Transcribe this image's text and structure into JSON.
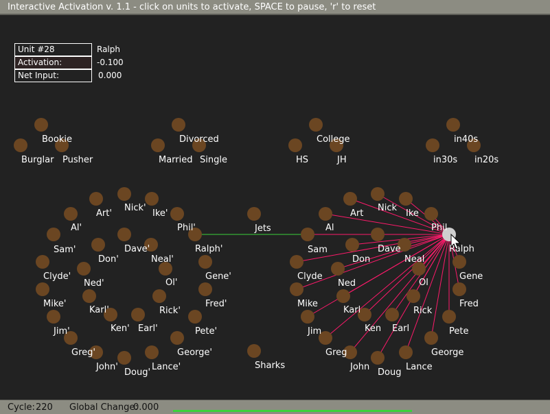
{
  "window": {
    "title": "Interactive Activation v. 1.1 - click on units to activate, SPACE to pause, 'r' to reset"
  },
  "info": {
    "unit_label": "Unit #28",
    "unit_name": "Ralph",
    "activation_label": "Activation:",
    "activation_value": "-0.100",
    "net_input_label": "Net Input:",
    "net_input_value": "0.000"
  },
  "status": {
    "cycle_label": "Cycle:",
    "cycle_value": "220",
    "global_change_label": "Global Change:",
    "global_change_value": "0.000",
    "progress_fraction": 1.0
  },
  "colors": {
    "background": "#222222",
    "unit_fill": "#6b4622",
    "selected_unit": "#cfcfcf",
    "label": "#ffffff",
    "excitatory_link": "#3bd23b",
    "inhibitory_link": "#ff1a6b"
  },
  "selected_unit": "Ralph",
  "groups": {
    "occupation": [
      "Bookie",
      "Burglar",
      "Pusher"
    ],
    "marital": [
      "Divorced",
      "Married",
      "Single"
    ],
    "education": [
      "College",
      "HS",
      "JH"
    ],
    "age": [
      "in40s",
      "in30s",
      "in20s"
    ],
    "gang": [
      "Jets",
      "Sharks"
    ]
  },
  "units": [
    {
      "name": "Bookie"
    },
    {
      "name": "Burglar"
    },
    {
      "name": "Pusher"
    },
    {
      "name": "Divorced"
    },
    {
      "name": "Married"
    },
    {
      "name": "Single"
    },
    {
      "name": "College"
    },
    {
      "name": "HS"
    },
    {
      "name": "JH"
    },
    {
      "name": "in40s"
    },
    {
      "name": "in30s"
    },
    {
      "name": "in20s"
    },
    {
      "name": "Jets"
    },
    {
      "name": "Sharks"
    },
    {
      "name": "Art'"
    },
    {
      "name": "Nick'"
    },
    {
      "name": "Ike'"
    },
    {
      "name": "Al'"
    },
    {
      "name": "Phil'"
    },
    {
      "name": "Sam'"
    },
    {
      "name": "Dave'"
    },
    {
      "name": "Don'"
    },
    {
      "name": "Neal'"
    },
    {
      "name": "Ralph'"
    },
    {
      "name": "Clyde'"
    },
    {
      "name": "Ned'"
    },
    {
      "name": "Ol'"
    },
    {
      "name": "Gene'"
    },
    {
      "name": "Mike'"
    },
    {
      "name": "Karl'"
    },
    {
      "name": "Rick'"
    },
    {
      "name": "Fred'"
    },
    {
      "name": "Jim'"
    },
    {
      "name": "Ken'"
    },
    {
      "name": "Earl'"
    },
    {
      "name": "Pete'"
    },
    {
      "name": "Greg'"
    },
    {
      "name": "John'"
    },
    {
      "name": "Doug'"
    },
    {
      "name": "Lance'"
    },
    {
      "name": "George'"
    },
    {
      "name": "Art"
    },
    {
      "name": "Nick"
    },
    {
      "name": "Ike"
    },
    {
      "name": "Al"
    },
    {
      "name": "Phil"
    },
    {
      "name": "Sam"
    },
    {
      "name": "Dave"
    },
    {
      "name": "Don"
    },
    {
      "name": "Neal"
    },
    {
      "name": "Ralph"
    },
    {
      "name": "Clyde"
    },
    {
      "name": "Ned"
    },
    {
      "name": "Ol"
    },
    {
      "name": "Gene"
    },
    {
      "name": "Mike"
    },
    {
      "name": "Karl"
    },
    {
      "name": "Rick"
    },
    {
      "name": "Fred"
    },
    {
      "name": "Jim"
    },
    {
      "name": "Ken"
    },
    {
      "name": "Earl"
    },
    {
      "name": "Pete"
    },
    {
      "name": "Greg"
    },
    {
      "name": "John"
    },
    {
      "name": "Doug"
    },
    {
      "name": "Lance"
    },
    {
      "name": "George"
    }
  ],
  "links": [
    {
      "from": "Ralph",
      "to": "Ralph'",
      "kind": "excitatory"
    },
    {
      "from": "Ralph",
      "to": "Art",
      "kind": "inhibitory"
    },
    {
      "from": "Ralph",
      "to": "Nick",
      "kind": "inhibitory"
    },
    {
      "from": "Ralph",
      "to": "Ike",
      "kind": "inhibitory"
    },
    {
      "from": "Ralph",
      "to": "Al",
      "kind": "inhibitory"
    },
    {
      "from": "Ralph",
      "to": "Phil",
      "kind": "inhibitory"
    },
    {
      "from": "Ralph",
      "to": "Sam",
      "kind": "inhibitory"
    },
    {
      "from": "Ralph",
      "to": "Dave",
      "kind": "inhibitory"
    },
    {
      "from": "Ralph",
      "to": "Don",
      "kind": "inhibitory"
    },
    {
      "from": "Ralph",
      "to": "Neal",
      "kind": "inhibitory"
    },
    {
      "from": "Ralph",
      "to": "Clyde",
      "kind": "inhibitory"
    },
    {
      "from": "Ralph",
      "to": "Ned",
      "kind": "inhibitory"
    },
    {
      "from": "Ralph",
      "to": "Ol",
      "kind": "inhibitory"
    },
    {
      "from": "Ralph",
      "to": "Gene",
      "kind": "inhibitory"
    },
    {
      "from": "Ralph",
      "to": "Mike",
      "kind": "inhibitory"
    },
    {
      "from": "Ralph",
      "to": "Karl",
      "kind": "inhibitory"
    },
    {
      "from": "Ralph",
      "to": "Rick",
      "kind": "inhibitory"
    },
    {
      "from": "Ralph",
      "to": "Fred",
      "kind": "inhibitory"
    },
    {
      "from": "Ralph",
      "to": "Jim",
      "kind": "inhibitory"
    },
    {
      "from": "Ralph",
      "to": "Ken",
      "kind": "inhibitory"
    },
    {
      "from": "Ralph",
      "to": "Earl",
      "kind": "inhibitory"
    },
    {
      "from": "Ralph",
      "to": "Pete",
      "kind": "inhibitory"
    },
    {
      "from": "Ralph",
      "to": "Greg",
      "kind": "inhibitory"
    },
    {
      "from": "Ralph",
      "to": "John",
      "kind": "inhibitory"
    },
    {
      "from": "Ralph",
      "to": "Doug",
      "kind": "inhibitory"
    },
    {
      "from": "Ralph",
      "to": "Lance",
      "kind": "inhibitory"
    },
    {
      "from": "Ralph",
      "to": "George",
      "kind": "inhibitory"
    }
  ]
}
